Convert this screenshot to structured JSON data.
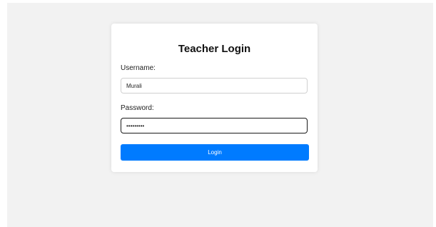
{
  "form": {
    "title": "Teacher Login",
    "username_label": "Username:",
    "username_value": "Murali",
    "password_label": "Password:",
    "password_value": "•••••••••",
    "login_label": "Login"
  },
  "colors": {
    "primary_button": "#007bff",
    "page_background": "#f2f2f2",
    "card_background": "#ffffff"
  }
}
